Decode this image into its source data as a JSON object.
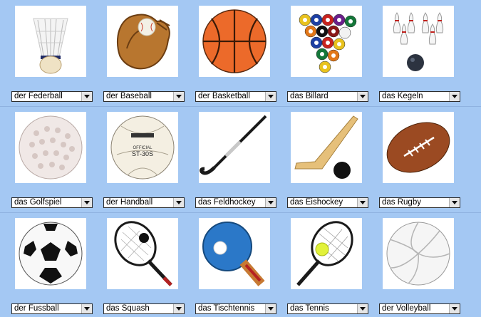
{
  "colors": {
    "background": "#a4c8f3",
    "select_border": "#2c2c2c"
  },
  "cards": [
    {
      "icon": "shuttlecock-icon",
      "label": "der Federball"
    },
    {
      "icon": "baseball-glove-icon",
      "label": "der Baseball"
    },
    {
      "icon": "basketball-icon",
      "label": "der Basketball"
    },
    {
      "icon": "billiard-balls-icon",
      "label": "das Billard"
    },
    {
      "icon": "bowling-pins-icon",
      "label": "das Kegeln"
    },
    {
      "icon": "golf-ball-icon",
      "label": "das Golfspiel"
    },
    {
      "icon": "handball-icon",
      "label": "der Handball"
    },
    {
      "icon": "field-hockey-stick-icon",
      "label": "das Feldhockey"
    },
    {
      "icon": "ice-hockey-stick-icon",
      "label": "das Eishockey"
    },
    {
      "icon": "rugby-ball-icon",
      "label": "das Rugby"
    },
    {
      "icon": "soccer-ball-icon",
      "label": "der Fussball"
    },
    {
      "icon": "squash-racket-icon",
      "label": "das Squash"
    },
    {
      "icon": "table-tennis-paddle-icon",
      "label": "das Tischtennis"
    },
    {
      "icon": "tennis-racket-icon",
      "label": "das Tennis"
    },
    {
      "icon": "volleyball-icon",
      "label": "der Volleyball"
    }
  ]
}
